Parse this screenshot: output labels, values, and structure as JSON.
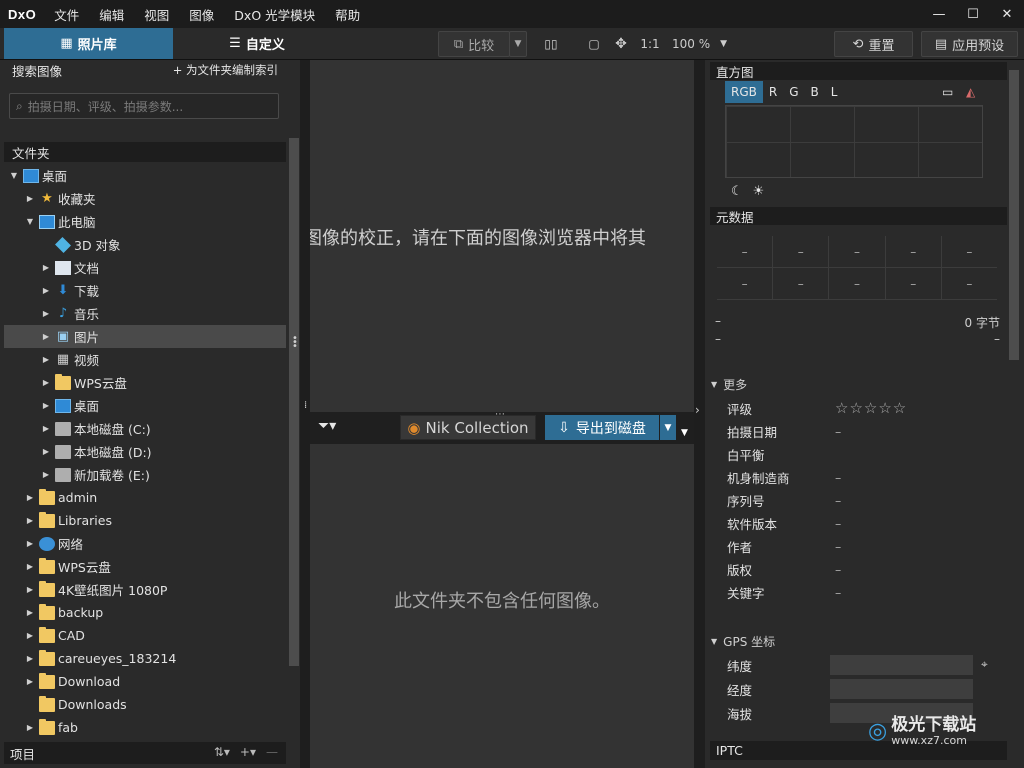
{
  "app": {
    "logo": "DxO",
    "menu": [
      "文件",
      "编辑",
      "视图",
      "图像",
      "DxO 光学模块",
      "帮助"
    ],
    "window_controls": [
      "minimize-icon",
      "maximize-icon",
      "close-icon"
    ]
  },
  "toolbar": {
    "tab_library": "照片库",
    "tab_customize": "自定义",
    "compare": "比较",
    "ratio": "1:1",
    "zoom": "100 %",
    "reset": "重置",
    "apply_preset": "应用预设"
  },
  "left": {
    "search_title": "搜索图像",
    "index_link": "+ 为文件夹编制索引",
    "search_placeholder": "拍摄日期、评级、拍摄参数...",
    "folders_title": "文件夹",
    "tree": [
      {
        "label": "桌面",
        "level": 0,
        "arrow": "▼",
        "icon": "desktop"
      },
      {
        "label": "收藏夹",
        "level": 1,
        "arrow": "▶",
        "icon": "star"
      },
      {
        "label": "此电脑",
        "level": 1,
        "arrow": "▼",
        "icon": "pc"
      },
      {
        "label": "3D 对象",
        "level": 2,
        "arrow": "",
        "icon": "cube"
      },
      {
        "label": "文档",
        "level": 2,
        "arrow": "▶",
        "icon": "doc"
      },
      {
        "label": "下载",
        "level": 2,
        "arrow": "▶",
        "icon": "download"
      },
      {
        "label": "音乐",
        "level": 2,
        "arrow": "▶",
        "icon": "music"
      },
      {
        "label": "图片",
        "level": 2,
        "arrow": "▶",
        "icon": "picture",
        "selected": true
      },
      {
        "label": "视频",
        "level": 2,
        "arrow": "▶",
        "icon": "video"
      },
      {
        "label": "WPS云盘",
        "level": 2,
        "arrow": "▶",
        "icon": "folder"
      },
      {
        "label": "桌面",
        "level": 2,
        "arrow": "▶",
        "icon": "desktop"
      },
      {
        "label": "本地磁盘 (C:)",
        "level": 2,
        "arrow": "▶",
        "icon": "drive"
      },
      {
        "label": "本地磁盘 (D:)",
        "level": 2,
        "arrow": "▶",
        "icon": "drive"
      },
      {
        "label": "新加载卷 (E:)",
        "level": 2,
        "arrow": "▶",
        "icon": "drive"
      },
      {
        "label": "admin",
        "level": 1,
        "arrow": "▶",
        "icon": "folder"
      },
      {
        "label": "Libraries",
        "level": 1,
        "arrow": "▶",
        "icon": "folder"
      },
      {
        "label": "网络",
        "level": 1,
        "arrow": "▶",
        "icon": "network"
      },
      {
        "label": "WPS云盘",
        "level": 1,
        "arrow": "▶",
        "icon": "folder"
      },
      {
        "label": "4K壁纸图片 1080P",
        "level": 1,
        "arrow": "▶",
        "icon": "folder"
      },
      {
        "label": "backup",
        "level": 1,
        "arrow": "▶",
        "icon": "folder"
      },
      {
        "label": "CAD",
        "level": 1,
        "arrow": "▶",
        "icon": "folder"
      },
      {
        "label": "careueyes_183214",
        "level": 1,
        "arrow": "▶",
        "icon": "folder"
      },
      {
        "label": "Download",
        "level": 1,
        "arrow": "▶",
        "icon": "folder"
      },
      {
        "label": "Downloads",
        "level": 1,
        "arrow": "",
        "icon": "folder"
      },
      {
        "label": "fab",
        "level": 1,
        "arrow": "▶",
        "icon": "folder"
      }
    ],
    "items_title": "项目"
  },
  "center": {
    "viewer_message": "图像的校正，请在下面的图像浏览器中将其",
    "nik_label": "Nik Collection",
    "export_label": "导出到磁盘",
    "empty_message": "此文件夹不包含任何图像。"
  },
  "right": {
    "histogram_title": "直方图",
    "hist_tabs": [
      "RGB",
      "R",
      "G",
      "B",
      "L"
    ],
    "metadata_title": "元数据",
    "meta_cells": [
      "–",
      "–",
      "–",
      "–",
      "–",
      "–",
      "–",
      "–",
      "–",
      "–"
    ],
    "size_left": "–",
    "size_value": "0 字节",
    "line2_left": "–",
    "line2_right": "–",
    "more_title": "更多",
    "fields": [
      {
        "k": "评级",
        "v": "☆☆☆☆☆"
      },
      {
        "k": "拍摄日期",
        "v": "–"
      },
      {
        "k": "白平衡",
        "v": ""
      },
      {
        "k": "机身制造商",
        "v": "–"
      },
      {
        "k": "序列号",
        "v": "–"
      },
      {
        "k": "软件版本",
        "v": "–"
      },
      {
        "k": "作者",
        "v": "–"
      },
      {
        "k": "版权",
        "v": "–"
      },
      {
        "k": "关键字",
        "v": "–"
      }
    ],
    "gps_title": "GPS 坐标",
    "gps_fields": [
      "纬度",
      "经度",
      "海拔"
    ],
    "iptc_title": "IPTC"
  },
  "watermark": {
    "text": "极光下载站",
    "url": "www.xz7.com"
  }
}
